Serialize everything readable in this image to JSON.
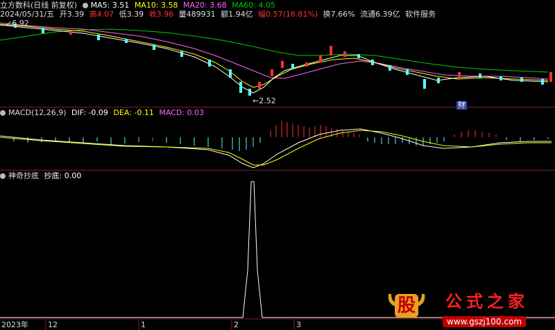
{
  "main": {
    "stock_title": "立方数科(日线 前复权)",
    "ma5_label": "MA5: 3.51",
    "ma10_label": "MA10: 3.58",
    "ma20_label": "MA20: 3.68",
    "ma60_label": "MA60: 4.05",
    "date_text": "2024/05/31/五",
    "open_text": "开3.39",
    "high_text": "高4.07",
    "low_text": "低3.39",
    "close_text": "收3.96",
    "volume_text": "量489931",
    "amount_text": "额1.94亿",
    "change_text": "幅0.57(16.81%)",
    "turnover_text": "换7.66%",
    "float_text": "流通6.39亿",
    "industry_text": "软件服务",
    "max_marker": "6.92",
    "min_marker": "2.52",
    "cai_badge": "财"
  },
  "macd": {
    "name": "MACD(12,26,9)",
    "dif": "DIF: -0.09",
    "dea": "DEA: -0.11",
    "macd": "MACD: 0.03"
  },
  "indicator": {
    "name": "神奇抄底",
    "value_label": "抄底: 0.00"
  },
  "time_axis": [
    "2023年",
    "12",
    "1",
    "2",
    "3"
  ],
  "watermark": {
    "logo_char": "股",
    "site_name": "公式之家",
    "url": "www.gszj100.com"
  },
  "colors": {
    "up": "#ff3030",
    "down": "#54ffff",
    "ma5": "#ffffff",
    "ma10": "#ffff00",
    "ma20": "#ff66ff",
    "ma60": "#00cc00",
    "divider": "#8b1c1c"
  }
}
